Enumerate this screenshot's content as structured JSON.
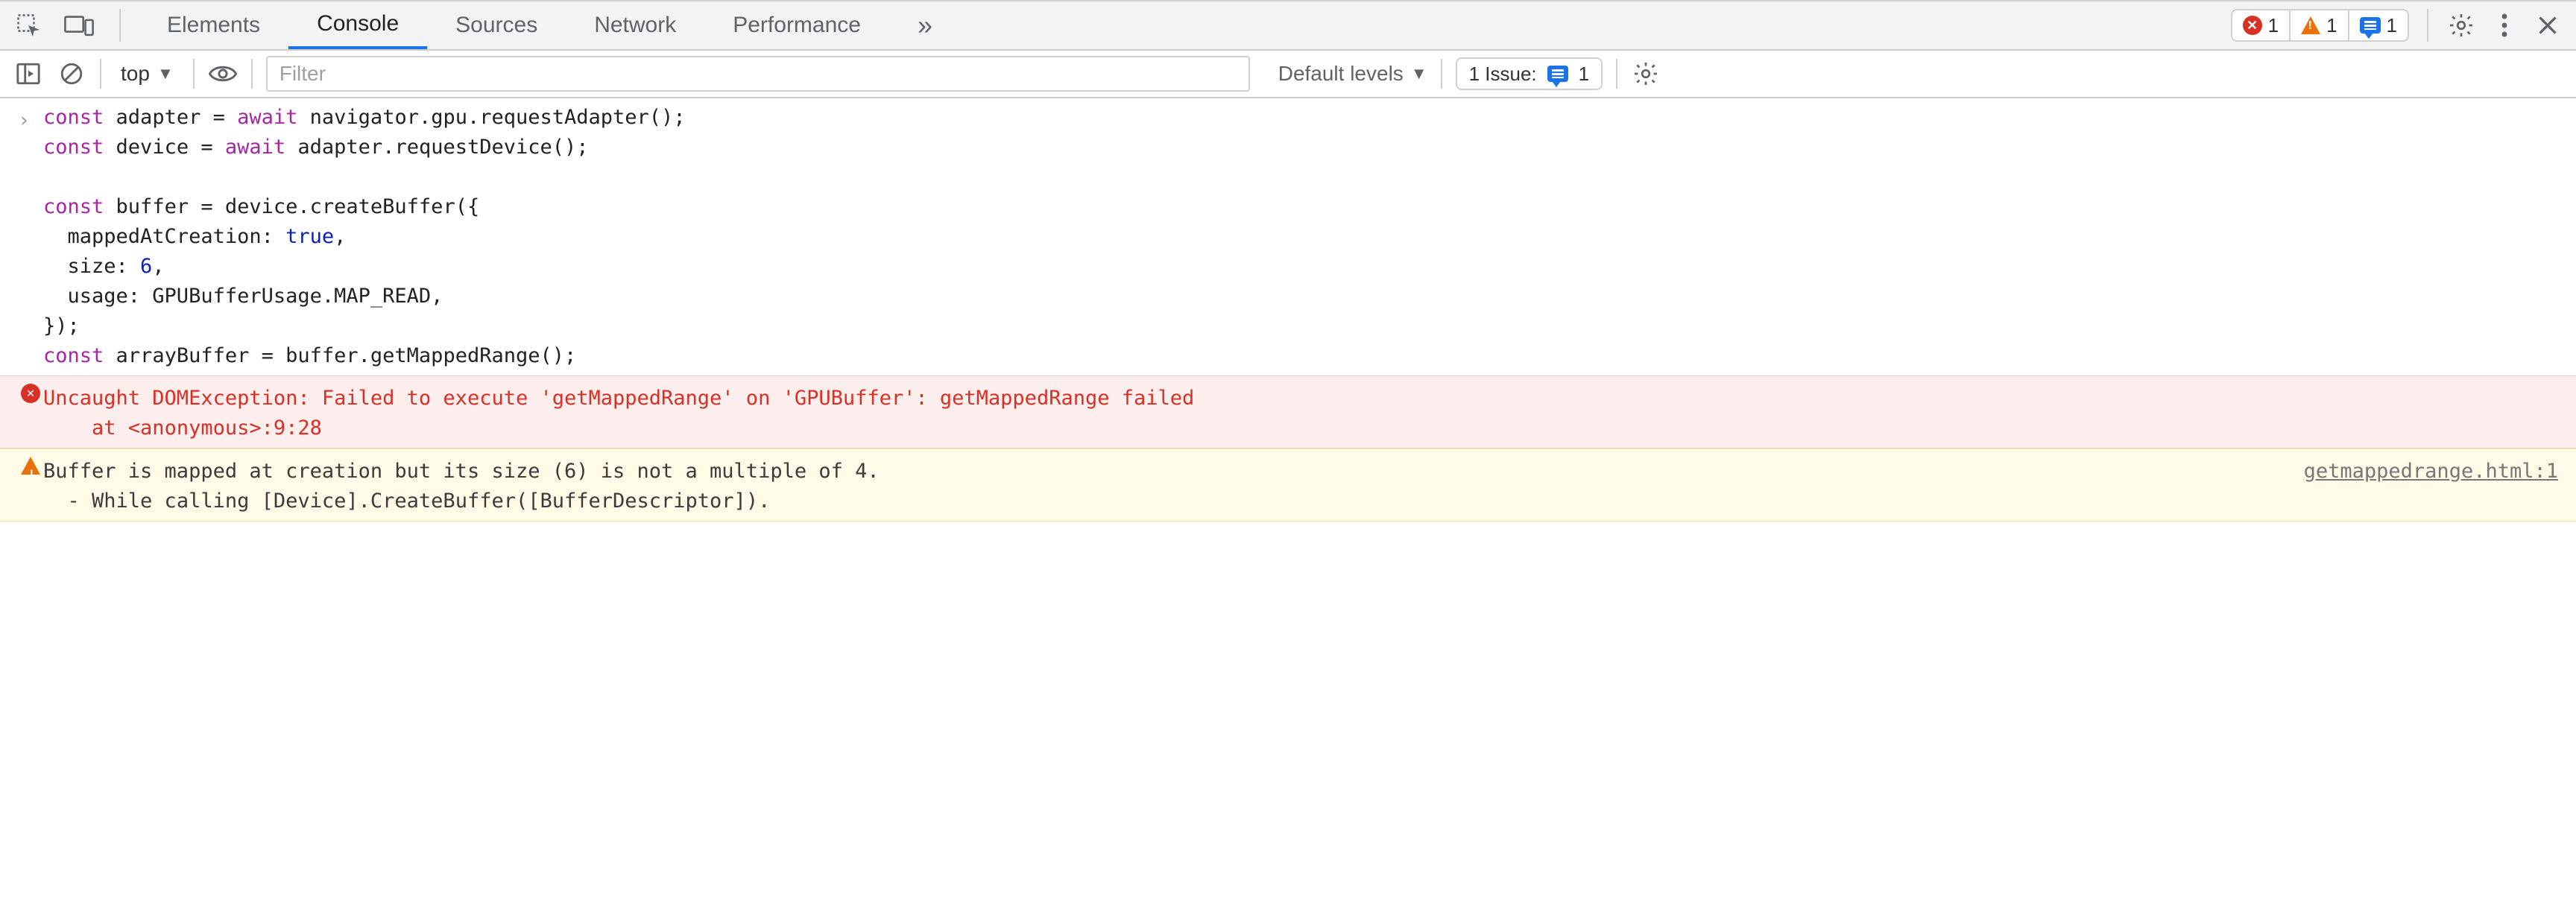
{
  "tabstrip": {
    "tabs": [
      "Elements",
      "Console",
      "Sources",
      "Network",
      "Performance"
    ],
    "active_index": 1,
    "more_glyph": "»",
    "error_count": "1",
    "warn_count": "1",
    "info_count": "1"
  },
  "toolbar": {
    "context_label": "top",
    "filter_placeholder": "Filter",
    "filter_value": "",
    "levels_label": "Default levels",
    "issues_label": "1 Issue:",
    "issues_count": "1"
  },
  "console": {
    "input_code_lines": [
      [
        {
          "t": "const ",
          "c": "kw"
        },
        {
          "t": "adapter = ",
          "c": ""
        },
        {
          "t": "await ",
          "c": "await"
        },
        {
          "t": "navigator.gpu.requestAdapter();",
          "c": ""
        }
      ],
      [
        {
          "t": "const ",
          "c": "kw"
        },
        {
          "t": "device = ",
          "c": ""
        },
        {
          "t": "await ",
          "c": "await"
        },
        {
          "t": "adapter.requestDevice();",
          "c": ""
        }
      ],
      [
        {
          "t": "",
          "c": ""
        }
      ],
      [
        {
          "t": "const ",
          "c": "kw"
        },
        {
          "t": "buffer = device.createBuffer({",
          "c": ""
        }
      ],
      [
        {
          "t": "  mappedAtCreation: ",
          "c": ""
        },
        {
          "t": "true",
          "c": "bool"
        },
        {
          "t": ",",
          "c": ""
        }
      ],
      [
        {
          "t": "  size: ",
          "c": ""
        },
        {
          "t": "6",
          "c": "num"
        },
        {
          "t": ",",
          "c": ""
        }
      ],
      [
        {
          "t": "  usage: GPUBufferUsage.MAP_READ,",
          "c": ""
        }
      ],
      [
        {
          "t": "});",
          "c": ""
        }
      ],
      [
        {
          "t": "const ",
          "c": "kw"
        },
        {
          "t": "arrayBuffer = buffer.getMappedRange();",
          "c": ""
        }
      ]
    ],
    "error": {
      "text": "Uncaught DOMException: Failed to execute 'getMappedRange' on 'GPUBuffer': getMappedRange failed\n    at <anonymous>:9:28"
    },
    "warn": {
      "text": "Buffer is mapped at creation but its size (6) is not a multiple of 4.\n  - While calling [Device].CreateBuffer([BufferDescriptor]).",
      "source": "getmappedrange.html:1"
    }
  },
  "icons": {
    "inspect": "inspect",
    "device": "device",
    "gear": "gear",
    "kebab": "kebab",
    "close": "close",
    "sidebar": "sidebar",
    "clear": "clear",
    "eye": "eye",
    "dropdown": "▾",
    "more_tabs": "»",
    "prompt": "›"
  }
}
